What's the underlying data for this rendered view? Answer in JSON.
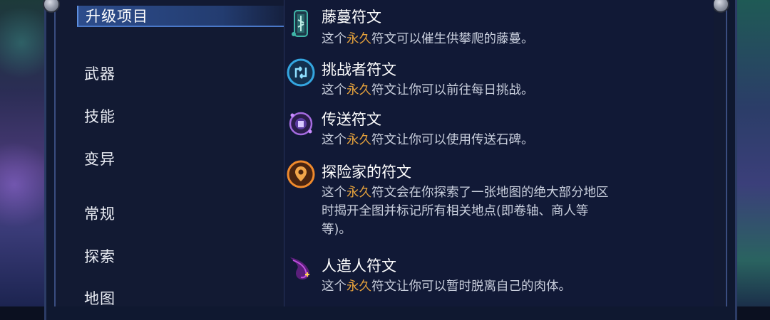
{
  "menu": {
    "items": [
      {
        "label": "升级项目",
        "active": true
      },
      {
        "label": "武器",
        "active": false
      },
      {
        "label": "技能",
        "active": false
      },
      {
        "label": "变异",
        "active": false
      },
      {
        "label": "常规",
        "active": false
      },
      {
        "label": "探索",
        "active": false
      },
      {
        "label": "地图",
        "active": false
      }
    ]
  },
  "runes": [
    {
      "name": "藤蔓符文",
      "icon": "vine-rune-icon",
      "desc_pre": "这个",
      "desc_hl": "永久",
      "desc_post": "符文可以催生供攀爬的藤蔓。"
    },
    {
      "name": "挑战者符文",
      "icon": "challenger-rune-icon",
      "desc_pre": "这个",
      "desc_hl": "永久",
      "desc_post": "符文让你可以前往每日挑战。"
    },
    {
      "name": "传送符文",
      "icon": "teleport-rune-icon",
      "desc_pre": "这个",
      "desc_hl": "永久",
      "desc_post": "符文让你可以使用传送石碑。"
    },
    {
      "name": "探险家的符文",
      "icon": "explorer-rune-icon",
      "desc_pre": "这个",
      "desc_hl": "永久",
      "desc_post_lines": [
        "符文会在你探索了一张地图的绝大部分地区",
        "时揭开全图并标记所有相关地点(即卷轴、商人等",
        "等)。"
      ]
    },
    {
      "name": "人造人符文",
      "icon": "homunculus-rune-icon",
      "desc_pre": "这个",
      "desc_hl": "永久",
      "desc_post": "符文让你可以暂时脱离自己的肉体。"
    }
  ],
  "colors": {
    "highlight": "#e6a23c",
    "active_tab": "#2d4d8c"
  }
}
